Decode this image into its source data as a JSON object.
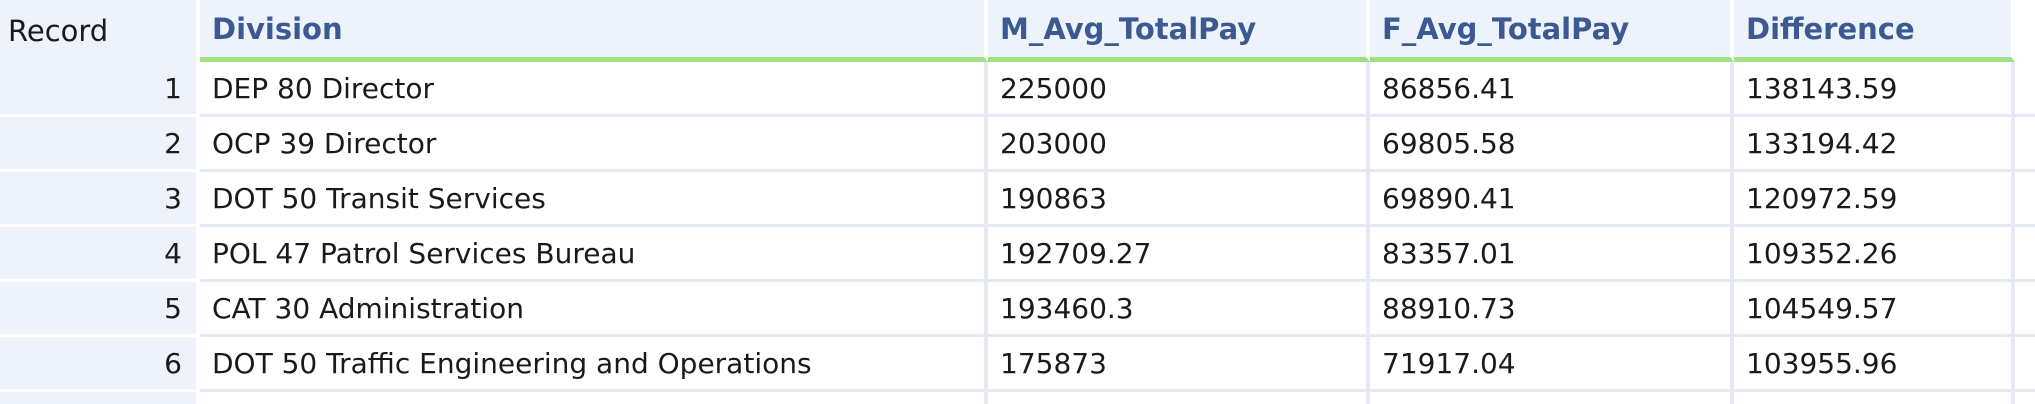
{
  "grid": {
    "columns": {
      "record": "Record",
      "division": "Division",
      "m_avg": "M_Avg_TotalPay",
      "f_avg": "F_Avg_TotalPay",
      "difference": "Difference"
    },
    "rows": [
      {
        "record": "1",
        "division": "DEP 80 Director",
        "m_avg": "225000",
        "f_avg": "86856.41",
        "difference": "138143.59"
      },
      {
        "record": "2",
        "division": "OCP 39 Director",
        "m_avg": "203000",
        "f_avg": "69805.58",
        "difference": "133194.42"
      },
      {
        "record": "3",
        "division": "DOT 50 Transit Services",
        "m_avg": "190863",
        "f_avg": "69890.41",
        "difference": "120972.59"
      },
      {
        "record": "4",
        "division": "POL 47 Patrol Services Bureau",
        "m_avg": "192709.27",
        "f_avg": "83357.01",
        "difference": "109352.26"
      },
      {
        "record": "5",
        "division": "CAT 30 Administration",
        "m_avg": "193460.3",
        "f_avg": "88910.73",
        "difference": "104549.57"
      },
      {
        "record": "6",
        "division": "DOT 50 Traffic Engineering and Operations",
        "m_avg": "175873",
        "f_avg": "71917.04",
        "difference": "103955.96"
      }
    ]
  },
  "colors": {
    "header_text": "#3b5a93",
    "header_underline": "#9fe085",
    "header_background": "#eef2fa",
    "grid_lines": "#e4e9f4"
  }
}
